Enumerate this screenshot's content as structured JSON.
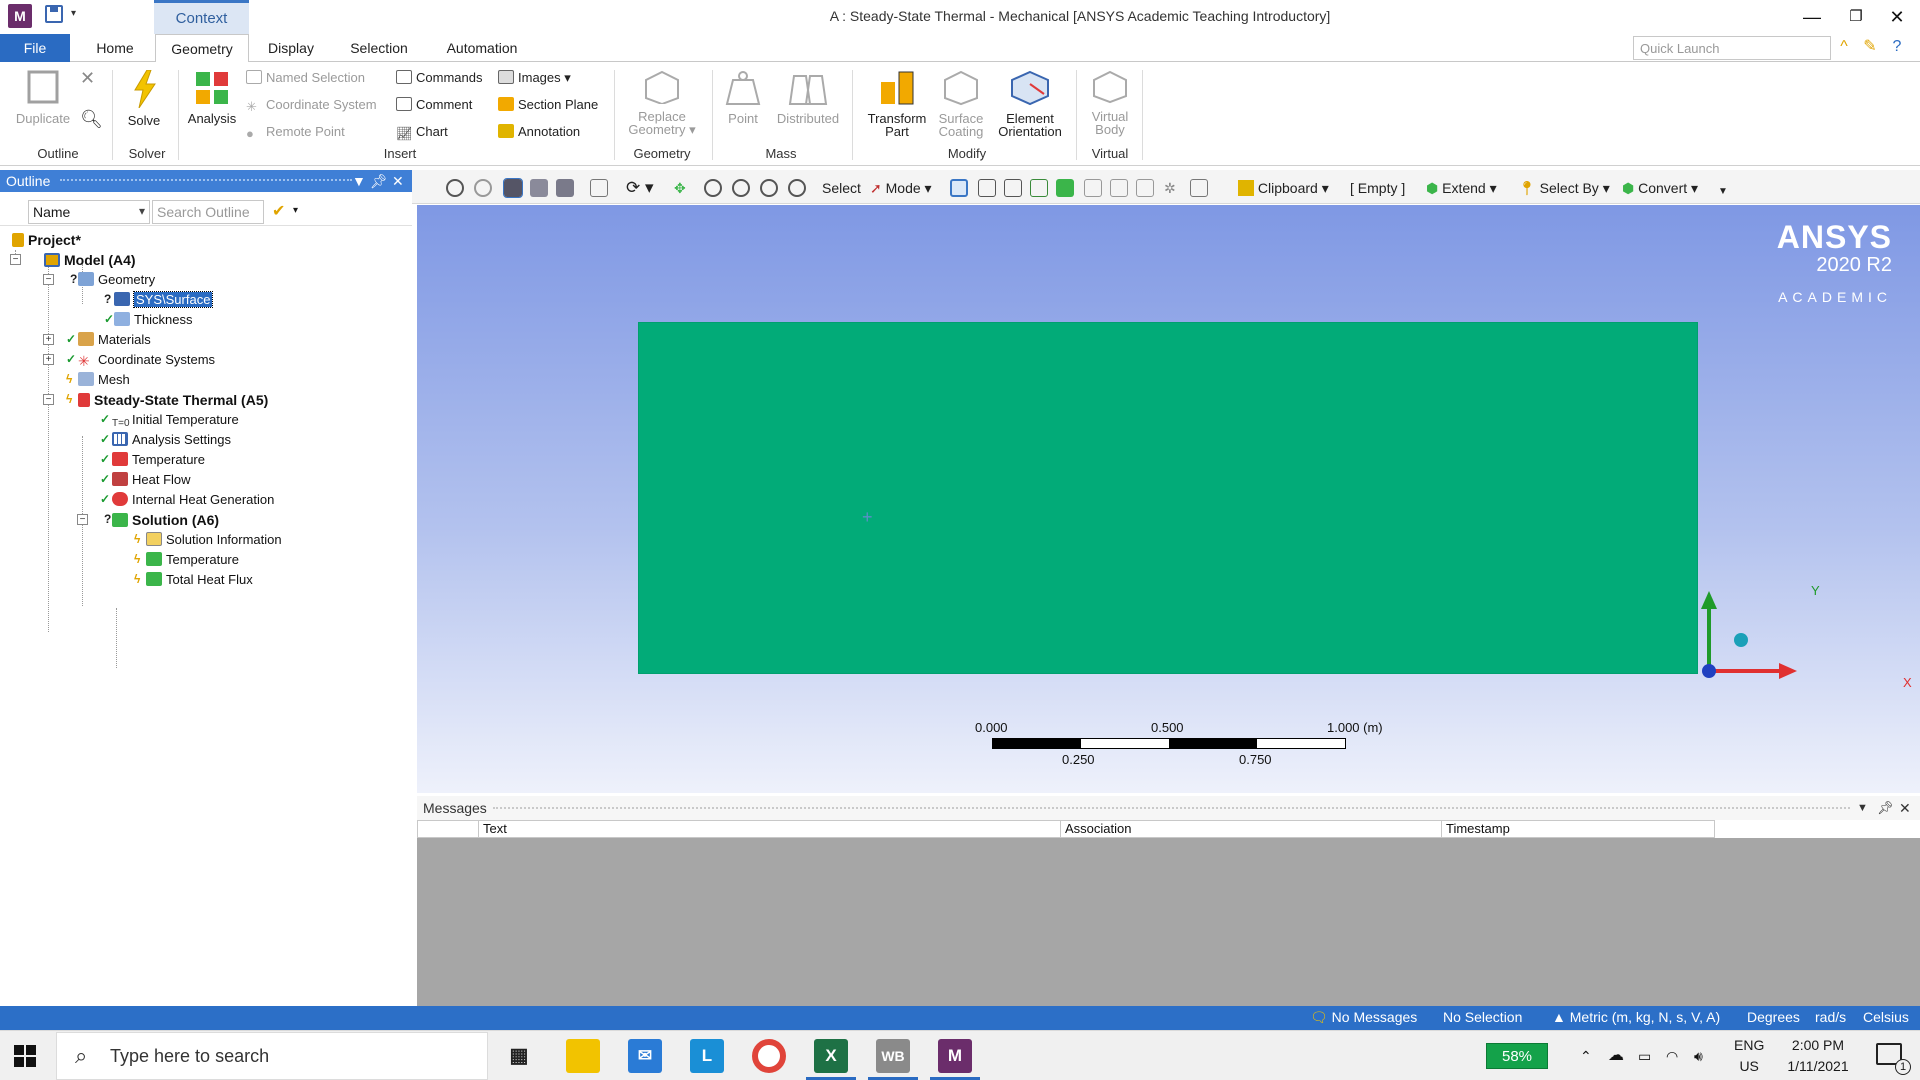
{
  "titlebar": {
    "app_icon_letter": "M",
    "context_tab": "Context",
    "window_title": "A : Steady-State Thermal - Mechanical [ANSYS Academic Teaching Introductory]"
  },
  "tabs": [
    "File",
    "Home",
    "Geometry",
    "Display",
    "Selection",
    "Automation"
  ],
  "quick_launch_placeholder": "Quick Launch",
  "ribbon": {
    "outline_group": {
      "duplicate": "Duplicate",
      "label": "Outline"
    },
    "solver_group": {
      "solve": "Solve",
      "label": "Solver"
    },
    "analysis": "Analysis",
    "insert_group": {
      "named_selection": "Named Selection",
      "coordinate_system": "Coordinate System",
      "remote_point": "Remote Point",
      "commands": "Commands",
      "comment": "Comment",
      "chart": "Chart",
      "images": "Images",
      "section_plane": "Section Plane",
      "annotation": "Annotation",
      "label": "Insert"
    },
    "geometry_group": {
      "replace_geometry_1": "Replace",
      "replace_geometry_2": "Geometry",
      "label": "Geometry"
    },
    "mass_group": {
      "point": "Point",
      "distributed": "Distributed",
      "label": "Mass"
    },
    "modify_group": {
      "transform_1": "Transform",
      "transform_2": "Part",
      "surface_1": "Surface",
      "surface_2": "Coating",
      "element_1": "Element",
      "element_2": "Orientation",
      "label": "Modify"
    },
    "virtual_group": {
      "virtual_1": "Virtual",
      "virtual_2": "Body",
      "label": "Virtual"
    }
  },
  "outline": {
    "title": "Outline",
    "name_select": "Name",
    "search_placeholder": "Search Outline",
    "tree": {
      "project": "Project*",
      "model": "Model (A4)",
      "geometry": "Geometry",
      "sys_surface": "SYS\\Surface",
      "thickness": "Thickness",
      "materials": "Materials",
      "coordinate_systems": "Coordinate Systems",
      "mesh": "Mesh",
      "steady_state": "Steady-State Thermal (A5)",
      "initial_temperature": "Initial Temperature",
      "analysis_settings": "Analysis Settings",
      "temperature": "Temperature",
      "heat_flow": "Heat Flow",
      "internal_heat_generation": "Internal Heat Generation",
      "solution": "Solution (A6)",
      "solution_information": "Solution Information",
      "sol_temperature": "Temperature",
      "total_heat_flux": "Total Heat Flux"
    }
  },
  "graphics_toolbar": {
    "select": "Select",
    "mode": "Mode",
    "clipboard": "Clipboard",
    "empty": "[ Empty ]",
    "extend": "Extend",
    "select_by": "Select By",
    "convert": "Convert"
  },
  "viewport": {
    "logo_line1": "ANSYS",
    "logo_line2": "2020 R2",
    "logo_line3": "ACADEMIC",
    "scale": {
      "t0": "0.000",
      "t2": "0.500",
      "t4": "1.000 (m)",
      "t1": "0.250",
      "t3": "0.750"
    },
    "axis_y": "Y",
    "axis_x": "X",
    "plate_color": "#02ab78"
  },
  "messages": {
    "title": "Messages",
    "columns": [
      "Text",
      "Association",
      "Timestamp"
    ]
  },
  "statusbar": {
    "no_messages": "No Messages",
    "no_selection": "No Selection",
    "units": "Metric (m, kg, N, s, V, A)",
    "degrees": "Degrees",
    "rads": "rad/s",
    "celsius": "Celsius"
  },
  "taskbar": {
    "search_placeholder": "Type here to search",
    "battery": "58%",
    "lang1": "ENG",
    "lang2": "US",
    "time": "2:00 PM",
    "date": "1/11/2021",
    "notification_count": "1",
    "apps": [
      "L",
      "WB",
      "M"
    ]
  }
}
